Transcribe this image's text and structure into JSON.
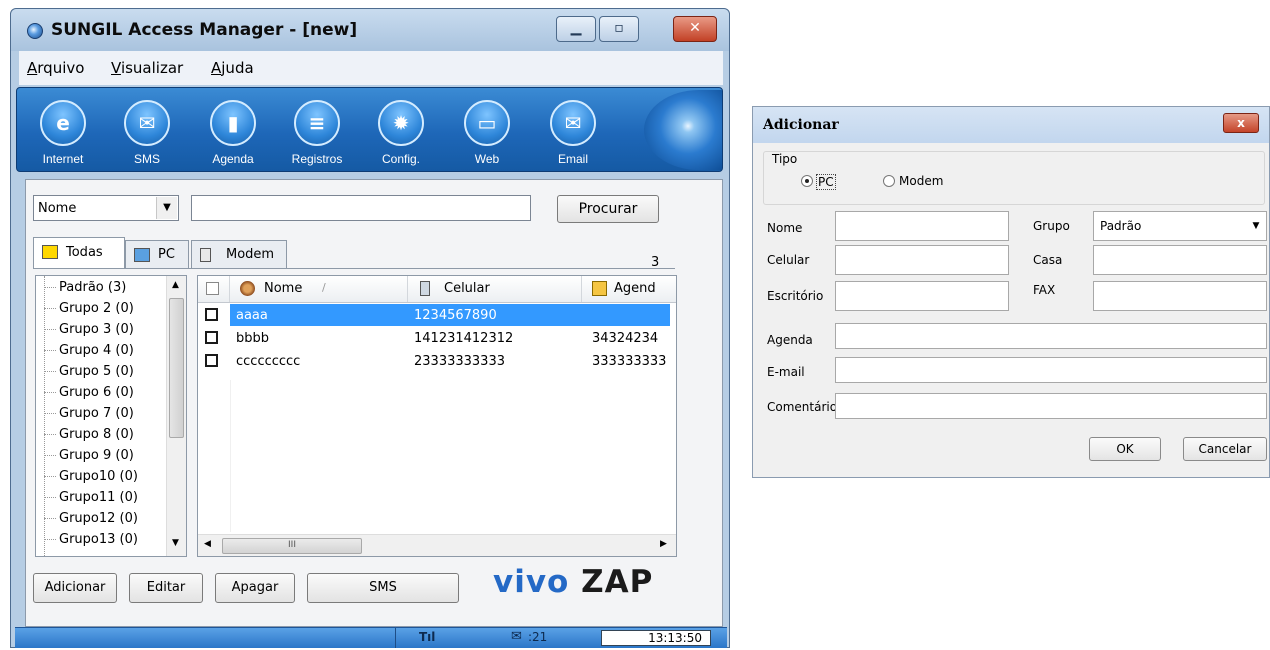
{
  "main_window": {
    "title": "SUNGIL Access Manager - [new]",
    "window_buttons": {
      "minimize": "▁",
      "maximize": "▫",
      "close": "✕"
    },
    "menu": [
      {
        "label": "Arquivo",
        "underline": "A",
        "rest": "rquivo"
      },
      {
        "label": "Visualizar",
        "underline": "V",
        "rest": "isualizar"
      },
      {
        "label": "Ajuda",
        "underline": "A",
        "rest": "juda"
      }
    ],
    "toolbar": [
      {
        "label": "Internet",
        "icon": "internet-icon",
        "glyph": "e"
      },
      {
        "label": "SMS",
        "icon": "sms-icon",
        "glyph": "✉"
      },
      {
        "label": "Agenda",
        "icon": "agenda-icon",
        "glyph": "▮"
      },
      {
        "label": "Registros",
        "icon": "registros-icon",
        "glyph": "≡"
      },
      {
        "label": "Config.",
        "icon": "config-icon",
        "glyph": "✹"
      },
      {
        "label": "Web",
        "icon": "web-icon",
        "glyph": "▭"
      },
      {
        "label": "Email",
        "icon": "email-icon",
        "glyph": "✉"
      }
    ],
    "search": {
      "field_select": "Nome",
      "query": "",
      "button": "Procurar"
    },
    "tabs": [
      {
        "label": "Todas"
      },
      {
        "label": "PC"
      },
      {
        "label": "Modem"
      }
    ],
    "count": "3",
    "groups": [
      "Padrão (3)",
      "Grupo 2 (0)",
      "Grupo 3 (0)",
      "Grupo 4 (0)",
      "Grupo 5 (0)",
      "Grupo 6 (0)",
      "Grupo 7 (0)",
      "Grupo 8 (0)",
      "Grupo 9 (0)",
      "Grupo10 (0)",
      "Grupo11 (0)",
      "Grupo12 (0)",
      "Grupo13 (0)"
    ],
    "columns": {
      "nome": "Nome",
      "celular": "Celular",
      "agenda": "Agend"
    },
    "contacts": [
      {
        "nome": "aaaa",
        "celular": "1234567890",
        "agenda": "",
        "selected": true
      },
      {
        "nome": "bbbb",
        "celular": "141231412312",
        "agenda": "34324234",
        "selected": false
      },
      {
        "nome": "ccccccccc",
        "celular": "23333333333",
        "agenda": "333333333",
        "selected": false
      }
    ],
    "hscroll_grip": "III",
    "buttons": {
      "add": "Adicionar",
      "edit": "Editar",
      "delete": "Apagar",
      "sms": "SMS"
    },
    "brand": {
      "vivo": "vivo",
      "zap": "ZAP"
    },
    "status": {
      "signal": "Tıl",
      "messages": ":21",
      "clock": "13:13:50"
    }
  },
  "dialog": {
    "title": "Adicionar",
    "close": "x",
    "tipo_label": "Tipo",
    "tipo_options": [
      "PC",
      "Modem"
    ],
    "tipo_selected": "PC",
    "labels": {
      "nome": "Nome",
      "celular": "Celular",
      "escritorio": "Escritório",
      "grupo": "Grupo",
      "casa": "Casa",
      "fax": "FAX",
      "agenda": "Agenda",
      "email": "E-mail",
      "comentario": "Comentário"
    },
    "grupo_value": "Padrão",
    "ok": "OK",
    "cancel": "Cancelar"
  },
  "colors": {
    "selection": "#3399ff",
    "toolbar": "#1e67b8",
    "brand_blue": "#2469c6"
  }
}
